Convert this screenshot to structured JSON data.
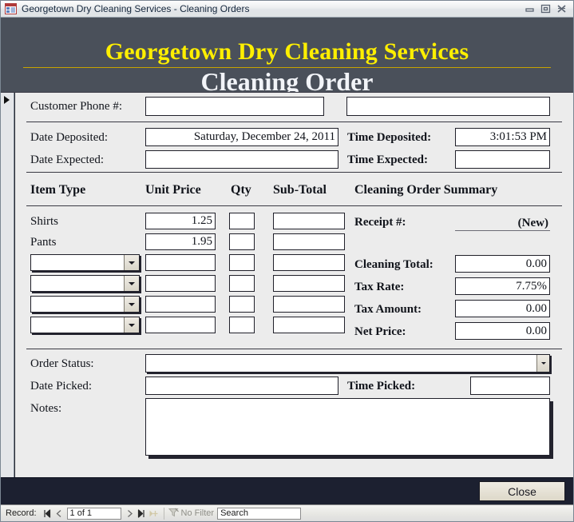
{
  "window": {
    "title": "Georgetown Dry Cleaning Services - Cleaning Orders",
    "icon": "access-form-icon",
    "buttons": {
      "minimize": "minimize-icon",
      "restore": "restore-icon",
      "close": "close-icon"
    }
  },
  "header": {
    "title": "Georgetown Dry Cleaning Services",
    "subtitle": "Cleaning Order",
    "title_color": "#ffef00",
    "subtitle_color": "#f2f4f8",
    "background_color": "#4a505a",
    "rule_color": "#c8a400"
  },
  "customer": {
    "phone_label": "Customer Phone #:",
    "phone_value": "",
    "name_value": ""
  },
  "dates": {
    "date_deposited_label": "Date Deposited:",
    "date_deposited_value": "Saturday, December 24, 2011",
    "time_deposited_label": "Time Deposited:",
    "time_deposited_value": "3:01:53 PM",
    "date_expected_label": "Date Expected:",
    "date_expected_value": "",
    "time_expected_label": "Time Expected:",
    "time_expected_value": ""
  },
  "items": {
    "headers": {
      "item_type": "Item Type",
      "unit_price": "Unit Price",
      "qty": "Qty",
      "sub_total": "Sub-Total"
    },
    "rows": [
      {
        "item_type": "Shirts",
        "is_combo": false,
        "unit_price": "1.25",
        "qty": "",
        "sub_total": ""
      },
      {
        "item_type": "Pants",
        "is_combo": false,
        "unit_price": "1.95",
        "qty": "",
        "sub_total": ""
      },
      {
        "item_type": "",
        "is_combo": true,
        "unit_price": "",
        "qty": "",
        "sub_total": ""
      },
      {
        "item_type": "",
        "is_combo": true,
        "unit_price": "",
        "qty": "",
        "sub_total": ""
      },
      {
        "item_type": "",
        "is_combo": true,
        "unit_price": "",
        "qty": "",
        "sub_total": ""
      },
      {
        "item_type": "",
        "is_combo": true,
        "unit_price": "",
        "qty": "",
        "sub_total": ""
      }
    ]
  },
  "summary": {
    "heading": "Cleaning Order Summary",
    "receipt_label": "Receipt #:",
    "receipt_value": "(New)",
    "rows": [
      {
        "label": "Cleaning Total:",
        "value": "0.00"
      },
      {
        "label": "Tax Rate:",
        "value": "7.75%"
      },
      {
        "label": "Tax Amount:",
        "value": "0.00"
      },
      {
        "label": "Net Price:",
        "value": "0.00"
      }
    ]
  },
  "status": {
    "order_status_label": "Order Status:",
    "order_status_value": "",
    "date_picked_label": "Date Picked:",
    "date_picked_value": "",
    "time_picked_label": "Time Picked:",
    "time_picked_value": "",
    "notes_label": "Notes:",
    "notes_value": ""
  },
  "footer": {
    "close_button": "Close"
  },
  "navbar": {
    "record_label": "Record:",
    "first_icon": "first-record-icon",
    "prev_icon": "previous-record-icon",
    "position": "1 of 1",
    "next_icon": "next-record-icon",
    "last_icon": "last-record-icon",
    "new_icon": "new-record-icon",
    "filter_icon": "filter-icon",
    "filter_label": "No Filter",
    "search_placeholder": "Search",
    "search_value": "Search"
  }
}
